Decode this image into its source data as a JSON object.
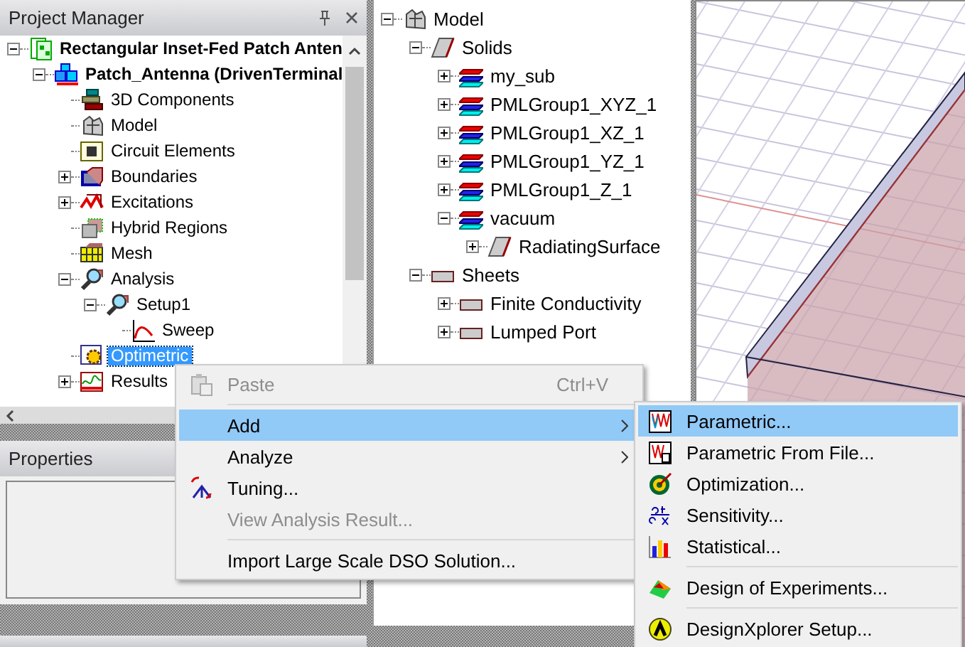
{
  "project_manager": {
    "title": "Project Manager",
    "tree": [
      {
        "label": "Rectangular Inset-Fed Patch Anten",
        "kind": "project",
        "expanded": true,
        "selected": false,
        "children": [
          {
            "label": "Patch_Antenna (DrivenTerminal",
            "kind": "design",
            "expanded": true,
            "selected": false,
            "children": [
              {
                "label": "3D Components",
                "kind": "components",
                "selected": false
              },
              {
                "label": "Model",
                "kind": "model",
                "selected": false
              },
              {
                "label": "Circuit Elements",
                "kind": "circuit",
                "selected": false
              },
              {
                "label": "Boundaries",
                "kind": "boundary",
                "expanded": false,
                "selected": false
              },
              {
                "label": "Excitations",
                "kind": "excitation",
                "expanded": false,
                "selected": false
              },
              {
                "label": "Hybrid Regions",
                "kind": "hybrid",
                "selected": false
              },
              {
                "label": "Mesh",
                "kind": "mesh",
                "selected": false
              },
              {
                "label": "Analysis",
                "kind": "analysis",
                "expanded": true,
                "selected": false,
                "children": [
                  {
                    "label": "Setup1",
                    "kind": "setup",
                    "expanded": true,
                    "selected": false,
                    "children": [
                      {
                        "label": "Sweep",
                        "kind": "sweep",
                        "selected": false
                      }
                    ]
                  }
                ]
              },
              {
                "label": "Optimetric",
                "kind": "optimetrics",
                "selected": true
              },
              {
                "label": "Results",
                "kind": "results",
                "expanded": false,
                "selected": false
              }
            ]
          }
        ]
      }
    ]
  },
  "properties": {
    "title": "Properties"
  },
  "model_tree": [
    {
      "label": "Model",
      "kind": "model",
      "expanded": true,
      "selected": false,
      "children": [
        {
          "label": "Solids",
          "kind": "solids",
          "expanded": true,
          "selected": false,
          "children": [
            {
              "label": "my_sub",
              "kind": "solid",
              "expanded": false,
              "selected": false
            },
            {
              "label": "PMLGroup1_XYZ_1",
              "kind": "solid",
              "expanded": false,
              "selected": false
            },
            {
              "label": "PMLGroup1_XZ_1",
              "kind": "solid",
              "expanded": false,
              "selected": false
            },
            {
              "label": "PMLGroup1_YZ_1",
              "kind": "solid",
              "expanded": false,
              "selected": false
            },
            {
              "label": "PMLGroup1_Z_1",
              "kind": "solid",
              "expanded": false,
              "selected": false
            },
            {
              "label": "vacuum",
              "kind": "solid",
              "expanded": true,
              "selected": false,
              "children": [
                {
                  "label": "RadiatingSurface",
                  "kind": "surface",
                  "expanded": false,
                  "selected": false
                }
              ]
            }
          ]
        },
        {
          "label": "Sheets",
          "kind": "sheets",
          "expanded": true,
          "selected": false,
          "children": [
            {
              "label": "Finite Conductivity",
              "kind": "sheet",
              "expanded": false,
              "selected": false
            },
            {
              "label": "Lumped Port",
              "kind": "sheet",
              "expanded": false,
              "selected": false
            }
          ]
        }
      ]
    }
  ],
  "context_menu": {
    "items": [
      {
        "label": "Paste",
        "kind": "paste",
        "shortcut": "Ctrl+V",
        "disabled": true,
        "selected": false,
        "submenu": false
      },
      {
        "kind": "separator"
      },
      {
        "label": "Add",
        "kind": "plain",
        "disabled": false,
        "selected": true,
        "submenu": true
      },
      {
        "label": "Analyze",
        "kind": "plain",
        "disabled": false,
        "selected": false,
        "submenu": true
      },
      {
        "label": "Tuning...",
        "kind": "tuning",
        "disabled": false,
        "selected": false,
        "submenu": false
      },
      {
        "label": "View Analysis Result...",
        "kind": "plain",
        "disabled": true,
        "selected": false,
        "submenu": false
      },
      {
        "kind": "separator"
      },
      {
        "label": "Import Large Scale DSO Solution...",
        "kind": "plain",
        "disabled": false,
        "selected": false,
        "submenu": false
      }
    ]
  },
  "submenu": {
    "items": [
      {
        "label": "Parametric...",
        "kind": "parametric",
        "disabled": false,
        "selected": true,
        "submenu": false
      },
      {
        "label": "Parametric From File...",
        "kind": "parametric-file",
        "disabled": false,
        "selected": false,
        "submenu": false
      },
      {
        "label": "Optimization...",
        "kind": "optimization",
        "disabled": false,
        "selected": false,
        "submenu": false
      },
      {
        "label": "Sensitivity...",
        "kind": "sensitivity",
        "disabled": false,
        "selected": false,
        "submenu": false
      },
      {
        "label": "Statistical...",
        "kind": "statistical",
        "disabled": false,
        "selected": false,
        "submenu": false
      },
      {
        "kind": "separator"
      },
      {
        "label": "Design of Experiments...",
        "kind": "doe",
        "disabled": false,
        "selected": false,
        "submenu": false
      },
      {
        "kind": "separator"
      },
      {
        "label": "DesignXplorer Setup...",
        "kind": "designxplorer",
        "disabled": false,
        "selected": false,
        "submenu": false
      }
    ]
  }
}
